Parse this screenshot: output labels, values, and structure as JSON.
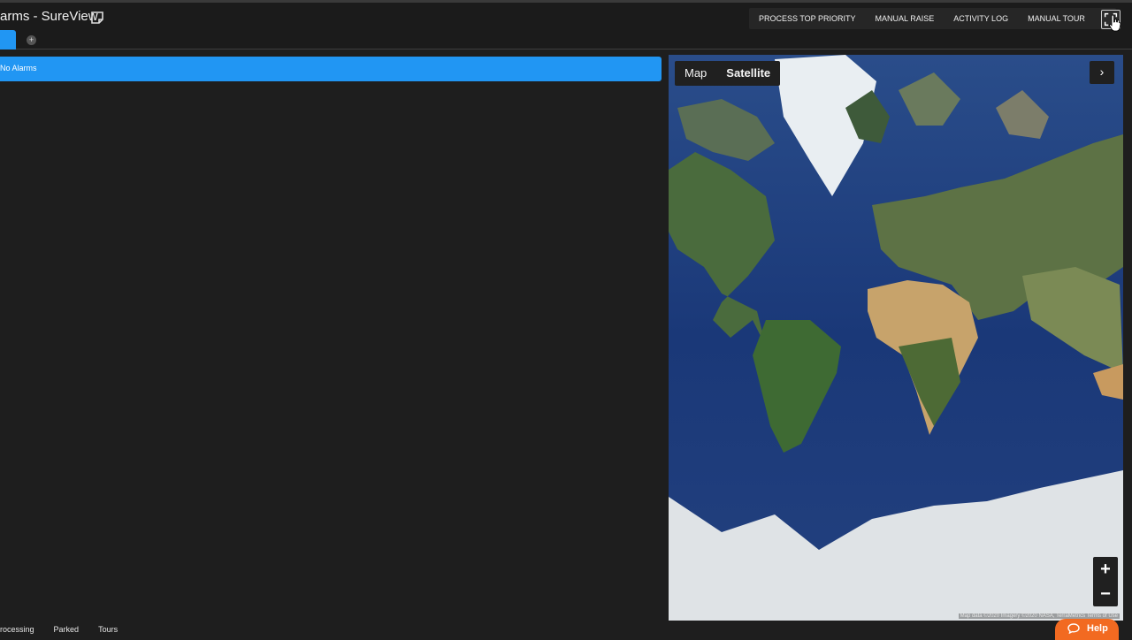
{
  "header": {
    "title": "arms - SureView",
    "actions": [
      "PROCESS TOP PRIORITY",
      "MANUAL RAISE",
      "ACTIVITY LOG",
      "MANUAL TOUR"
    ],
    "help_label": "?"
  },
  "tabs": {
    "add_label": "+"
  },
  "alarm_queue": {
    "status_text": "No Alarms"
  },
  "map": {
    "type_options": [
      "Map",
      "Satellite"
    ],
    "selected_type": "Satellite",
    "expand_label": "›",
    "zoom_in_label": "+",
    "zoom_out_label": "−",
    "attribution": "Map data ©2020 Imagery ©2020 NASA, TerraMetrics  Terms of Use"
  },
  "bottom_tabs": [
    "rocessing",
    "Parked",
    "Tours"
  ],
  "help_widget": {
    "label": "Help"
  },
  "colors": {
    "accent": "#2196f3",
    "help": "#f26a21",
    "background": "#1e1e1e"
  }
}
